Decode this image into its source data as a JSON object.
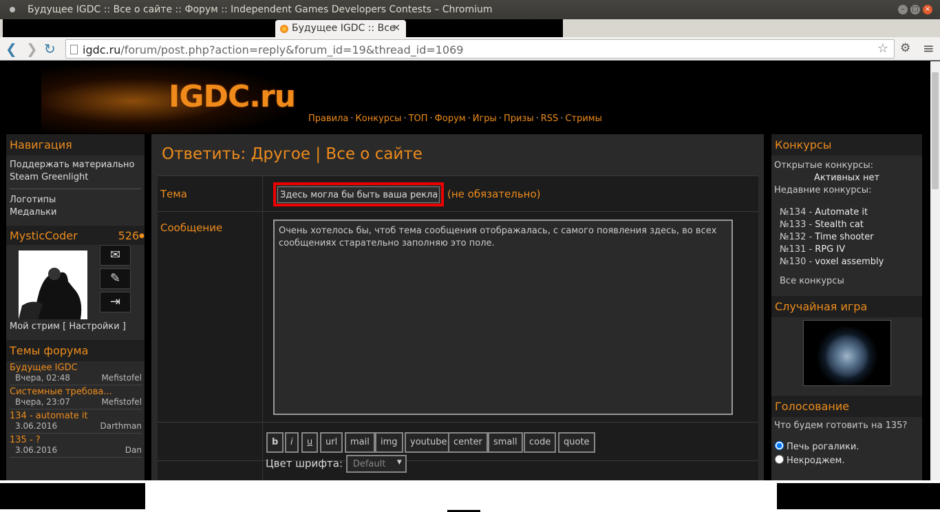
{
  "window": {
    "title": "Будущее IGDC :: Все о сайте :: Форум :: Independent Games Developers Contests – Chromium"
  },
  "tab": {
    "label": "Будущее IGDC :: Все"
  },
  "address": {
    "host": "igdc.ru",
    "path": "/forum/post.php?action=reply&forum_id=19&thread_id=1069"
  },
  "site": {
    "logo": "IGDC.ru",
    "nav": [
      "Правила",
      "Конкурсы",
      "ТОП",
      "Форум",
      "Игры",
      "Призы",
      "RSS",
      "Стримы"
    ]
  },
  "left": {
    "nav_title": "Навигация",
    "nav_links_a": [
      "Поддержать материально",
      "Steam Greenlight"
    ],
    "nav_links_b": [
      "Логотипы",
      "Медальки"
    ],
    "user_name": "MysticCoder",
    "user_points": "526",
    "stream_line": "Мой стрим [ Настройки ]",
    "topics_title": "Темы форума",
    "topics": [
      {
        "title": "Будущее IGDC",
        "date": "Вчера, 02:48",
        "author": "Mefistofel"
      },
      {
        "title": "Системные требова...",
        "date": "Вчера, 23:07",
        "author": "Mefistofel"
      },
      {
        "title": "134 - automate it",
        "date": "3.06.2016",
        "author": "Darthman"
      },
      {
        "title": "135 - ?",
        "date": "3.06.2016",
        "author": "Dan"
      }
    ]
  },
  "main": {
    "heading": "Ответить: Другое | Все о сайте",
    "subject_label": "Тема",
    "subject_value": "Здесь могла бы быть ваша реклама",
    "subject_note": "(не обязательно)",
    "message_label": "Сообщение",
    "message_value": "Очень хотелось бы, чтоб тема сообщения отображалась, с самого появления здесь, во всех сообщениях старательно заполняю это поле.",
    "format_buttons": [
      "b",
      "i",
      "u",
      "url",
      "mail",
      "img",
      "youtube",
      "center",
      "small",
      "code",
      "quote"
    ],
    "font_color_label": "Цвет шрифта:",
    "font_color_value": "Default"
  },
  "right": {
    "contests_title": "Конкурсы",
    "open_label": "Открытые конкурсы:",
    "open_value": "Активных нет",
    "recent_label": "Недавние конкурсы:",
    "recent": [
      {
        "num": "№134 - ",
        "name": "Automate it"
      },
      {
        "num": "№133 - ",
        "name": "Stealth cat"
      },
      {
        "num": "№132 - ",
        "name": "Time shooter"
      },
      {
        "num": "№131 - ",
        "name": "RPG IV"
      },
      {
        "num": "№130 - ",
        "name": "voxel assembly"
      }
    ],
    "all_contests": "Все конкурсы",
    "random_game_title": "Случайная игра",
    "poll_title": "Голосование",
    "poll_question": "Что будем готовить на 135?",
    "poll_options": [
      "Печь рогалики.",
      "Некроджем."
    ]
  }
}
